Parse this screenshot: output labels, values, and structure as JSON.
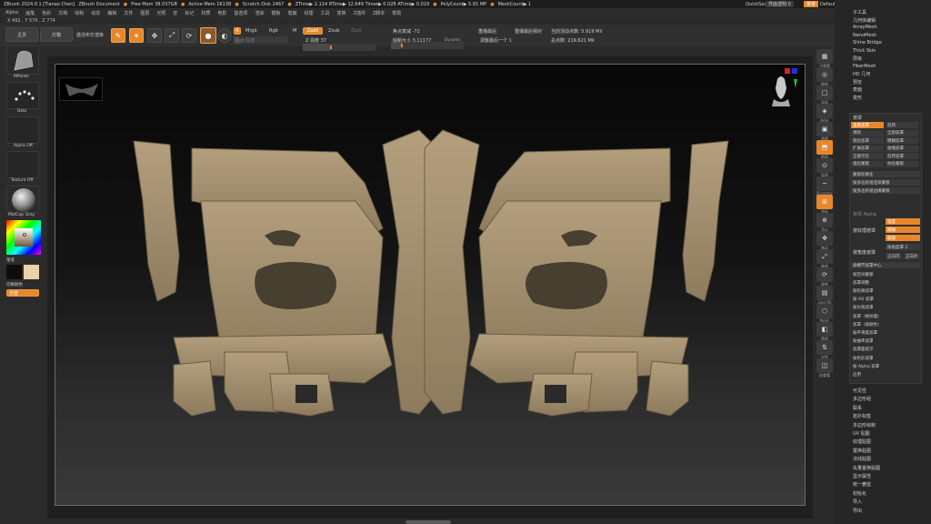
{
  "titlebar": {
    "app": "ZBrush 2024.0.1 [Tianao Chen]",
    "doc": "ZBrush Document",
    "free_mem": "Free Mem 38.037GB",
    "active_mem": "Active Mem 1613B",
    "scratch": "Scratch Disk 2467",
    "ztime": "ZTime▶ 2.114 RTime▶ 12.649 Timer▶ 0.028 ATime▶ 0.019",
    "polycount": "PolyCount▶ 5.91 MP",
    "meshcount": "MeshCount▶ 1",
    "quicksave": "QuickSave",
    "transparency": "界面透明 0",
    "menu_btn": "菜单",
    "script": "DefaultZScript"
  },
  "menubar": [
    "Alpha",
    "画笔",
    "色彩",
    "文档",
    "绘制",
    "动态",
    "编辑",
    "文件",
    "图层",
    "光照",
    "宏",
    "标记",
    "材质",
    "电影",
    "首选项",
    "渲染",
    "模板",
    "笔触",
    "纹理",
    "工具",
    "变换",
    "Z插件",
    "Z脚本",
    "帮助"
  ],
  "coords": "X 492 , Y 576 , Z 774",
  "toolbar": {
    "home": "主页",
    "lightbox": "灯箱",
    "toggle_live": "激活布尔渲染",
    "a": "A",
    "mrgb": "Mrgb",
    "rgb": "Rgb",
    "m": "M",
    "zadd": "Zadd",
    "zsub": "Zsub",
    "zcut": "Zcut",
    "rgb_intensity": "Rgb 强度",
    "z_intensity": "Z 强度 37",
    "focal_shift": "焦点衰减 -72",
    "draw_size": "绘制大小 3.11177",
    "dynamic": "Dynamic",
    "replay_last": "重播最后",
    "replay_last_rel": "重播最后相对",
    "adjust_last": "调整最后一个 1",
    "active_points": "当前活动点数: 5.919 Mil",
    "total_points": "总点数: 219.621 Mil"
  },
  "leftpanel": {
    "brush": "MPolish",
    "stroke": "Dots",
    "alpha": "Alpha Off",
    "texture": "Texture Off",
    "material": "MatCap Gray",
    "gradient": "渐变",
    "switch_color": "切换颜色",
    "alternate": "交替",
    "main_color": "#0d0d0d",
    "secondary_color": "#e9d3a8"
  },
  "rightstrip": [
    "子像素",
    "缩放",
    "实际",
    "AA半",
    "透视",
    "地面",
    "局部",
    "Dynamic",
    "坐标",
    "Xyz",
    "移动",
    "缩放",
    "旋转",
    "Line Fill",
    "PolyF",
    "透明",
    "对齐",
    "仅查看"
  ],
  "rightpanel": {
    "top_items": [
      "子工具",
      "几何体编辑",
      "ArrayMesh",
      "NanoMesh",
      "Slime Bridge",
      "Thick Skin",
      "层级",
      "FiberMesh",
      "HD 几何",
      "预览",
      "表面",
      "变形"
    ],
    "mask_title": "遮罩",
    "mask_rows": [
      [
        "查看遮罩",
        "反转"
      ],
      [
        "清除",
        "全部遮罩"
      ],
      [
        "锐化遮罩",
        "模糊遮罩"
      ],
      [
        "扩展遮罩",
        "收缩遮罩"
      ],
      [
        "全部可见",
        "反转遮罩"
      ],
      [
        "强化蒙版",
        "抗化蒙版"
      ]
    ],
    "mask_options": [
      "蒙版轮廓化",
      "按多边形组连续蒙版",
      "按多边形组边缘蒙版"
    ],
    "alpha_mask": "遮罩 Alpha",
    "by_texture": "按纹理遮罩",
    "strength_opts": [
      "强度",
      "模糊",
      "缩放"
    ],
    "angle_mask": "按角度遮罩",
    "angle_val": "按角度罩 2",
    "angle_opts": [
      "正向内",
      "正向外"
    ],
    "mask_center": "按细节遮罩中心",
    "mask_list": [
      "按空间蒙版",
      "遮罩调整",
      "按轮廓遮罩",
      "按 AO 遮罩",
      "按尖锐遮罩",
      "遮罩（按纹理）",
      "遮罩（按颜色）",
      "按平滑度遮罩",
      "按曲率遮罩",
      "遮罩面提示",
      "按色彩遮罩",
      "按 Alpha 遮罩",
      "应用"
    ],
    "bottom_items": [
      "可见性",
      "多边形组",
      "联系",
      "拓扑标签",
      "多边形绘制",
      "UV 贴图",
      "纹理贴图",
      "置换贴图",
      "法线贴图",
      "矢量置换贴图",
      "显示属性",
      "统一蒼蓝",
      "初始化",
      "导入",
      "导出"
    ]
  }
}
